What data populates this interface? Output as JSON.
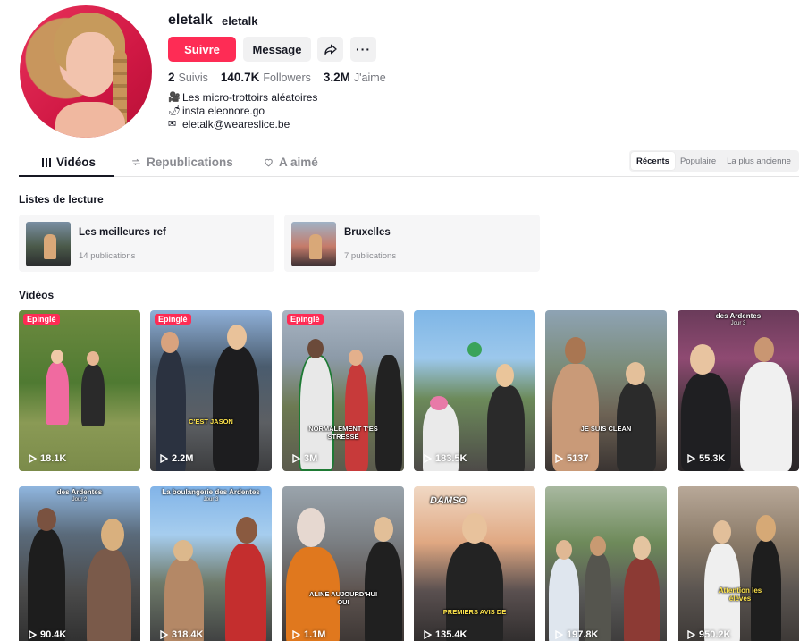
{
  "profile": {
    "username": "eletalk",
    "nickname": "eletalk",
    "follow_label": "Suivre",
    "message_label": "Message",
    "more_label": "···",
    "stats": [
      {
        "value": "2",
        "label": "Suivis"
      },
      {
        "value": "140.7K",
        "label": "Followers"
      },
      {
        "value": "3.2M",
        "label": "J'aime"
      }
    ],
    "bio": [
      {
        "emoji": "🎥",
        "text": "Les micro-trottoirs aléatoires"
      },
      {
        "emoji": "🌶",
        "text": "insta eleonore.go"
      },
      {
        "emoji": "✉",
        "text": "eletalk@weareslice.be"
      }
    ]
  },
  "tabs": [
    {
      "label": "Vidéos",
      "icon": "grid-icon"
    },
    {
      "label": "Republications",
      "icon": "repost-icon"
    },
    {
      "label": "A aimé",
      "icon": "heart-icon"
    }
  ],
  "sort": [
    "Récents",
    "Populaire",
    "La plus ancienne"
  ],
  "playlists_title": "Listes de lecture",
  "playlists": [
    {
      "title": "Les meilleures ref",
      "count": "14 publications"
    },
    {
      "title": "Bruxelles",
      "count": "7 publications"
    }
  ],
  "videos_title": "Vidéos",
  "pinned_label": "Epinglé",
  "videos": [
    {
      "views": "18.1K",
      "pinned": true,
      "caption": "",
      "header": "",
      "header_sub": ""
    },
    {
      "views": "2.2M",
      "pinned": true,
      "caption": "C'EST JASON",
      "header": "",
      "header_sub": ""
    },
    {
      "views": "3M",
      "pinned": true,
      "caption": "NORMALEMENT T'ES STRESSÉ",
      "header": "",
      "header_sub": ""
    },
    {
      "views": "183.5K",
      "pinned": false,
      "caption": "",
      "header": "",
      "header_sub": ""
    },
    {
      "views": "5137",
      "pinned": false,
      "caption": "JE SUIS CLEAN",
      "header": "",
      "header_sub": ""
    },
    {
      "views": "55.3K",
      "pinned": false,
      "caption": "",
      "header": "des Ardentes",
      "header_sub": "Jour 3"
    },
    {
      "views": "90.4K",
      "pinned": false,
      "caption": "",
      "header": "des Ardentes",
      "header_sub": "Jour 2"
    },
    {
      "views": "318.4K",
      "pinned": false,
      "caption": "",
      "header": "La boulangerie des Ardentes",
      "header_sub": "Jour 3"
    },
    {
      "views": "1.1M",
      "pinned": false,
      "caption": "ALINE AUJOURD'HUI OUI",
      "header": "",
      "header_sub": ""
    },
    {
      "views": "135.4K",
      "pinned": false,
      "caption": "PREMIERS AVIS DE",
      "header": "DAMSO",
      "header_sub": ""
    },
    {
      "views": "197.8K",
      "pinned": false,
      "caption": "",
      "header": "",
      "header_sub": ""
    },
    {
      "views": "950.2K",
      "pinned": false,
      "caption": "Attention les élèves",
      "header": "",
      "header_sub": ""
    }
  ],
  "colors": {
    "accent": "#fe2c55",
    "text": "#161823",
    "muted": "#73757c",
    "surface": "#f1f1f2"
  }
}
